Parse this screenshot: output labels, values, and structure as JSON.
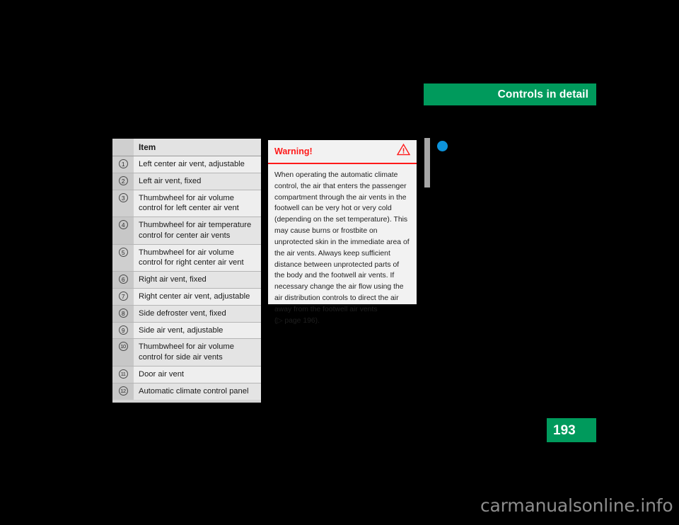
{
  "header": {
    "title": "Controls in detail",
    "accent_color": "#009a5c"
  },
  "page_tab": {
    "number": "193",
    "color": "#009a5c"
  },
  "margin_marks": {
    "bar_color": "#a6a6a6",
    "dot_color": "#0d93db",
    "bar_name": "margin-gray-bar",
    "dot_name": "margin-blue-dot"
  },
  "item_table": {
    "columns": [
      "",
      "Item"
    ],
    "header_label": "Item",
    "rows": [
      {
        "num": "1",
        "text": "Left center air vent, adjustable"
      },
      {
        "num": "2",
        "text": "Left air vent, fixed"
      },
      {
        "num": "3",
        "text": "Thumbwheel for air volume control for left center air vent"
      },
      {
        "num": "4",
        "text": "Thumbwheel for air temperature control for center air vents"
      },
      {
        "num": "5",
        "text": "Thumbwheel for air volume control for right center air vent"
      },
      {
        "num": "6",
        "text": "Right air vent, fixed"
      },
      {
        "num": "7",
        "text": "Right center air vent, adjustable"
      },
      {
        "num": "8",
        "text": "Side defroster vent, fixed"
      },
      {
        "num": "9",
        "text": "Side air vent, adjustable"
      },
      {
        "num": "10",
        "text": "Thumbwheel for air volume control for side air vents"
      },
      {
        "num": "11",
        "text": "Door air vent"
      },
      {
        "num": "12",
        "text": "Automatic climate control panel"
      }
    ]
  },
  "warning": {
    "title": "Warning!",
    "icon": "warning-triangle-icon",
    "accent_color": "#ff1a1a",
    "body": "When operating the automatic climate control, the air that enters the passenger compartment through the air vents in the footwell can be very hot or very cold (depending on the set temperature). This may cause burns or frostbite on unprotected skin in the immediate area of the air vents. Always keep sufficient distance between unprotected parts of the body and the footwell air vents. If necessary change the air flow using the air distribution controls to direct the air away from the footwell air vents",
    "cross_reference": "(▷ page 196)."
  },
  "watermark": {
    "text": "carmanualsonline.info"
  }
}
